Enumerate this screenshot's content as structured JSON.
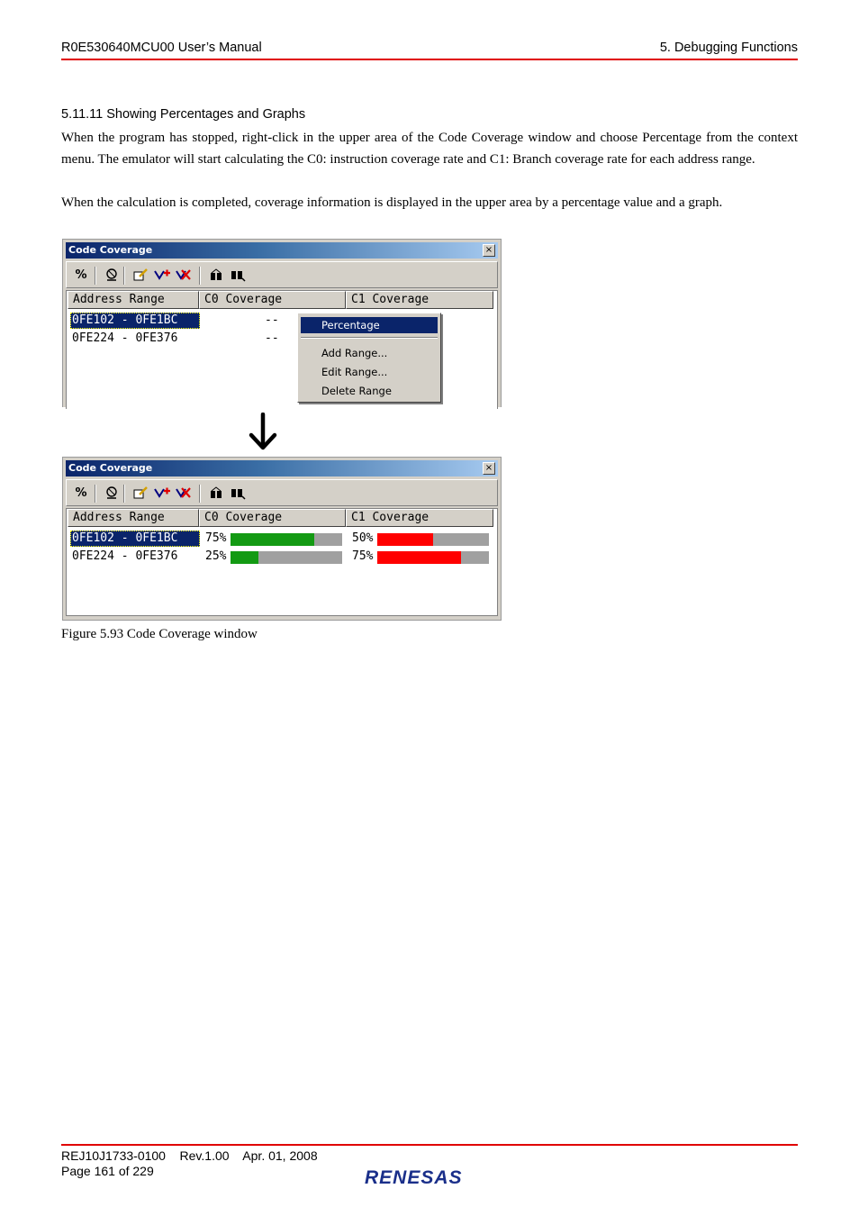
{
  "header": {
    "left": "R0E530640MCU00 User’s Manual",
    "right": "5. Debugging Functions"
  },
  "section_title": "5.11.11 Showing Percentages and Graphs",
  "paragraphs": [
    "When the program has stopped, right-click in the upper area of the Code Coverage window and choose Percentage from the context menu. The emulator will start calculating the C0: instruction coverage rate and C1: Branch coverage rate for each address range.",
    "When the calculation is completed, coverage information is displayed in the upper area by a percentage value and a graph."
  ],
  "window": {
    "title": "Code Coverage",
    "close_glyph": "×",
    "columns": [
      "Address Range",
      "C0 Coverage",
      "C1 Coverage"
    ],
    "toolbar_icons": [
      "percent-icon",
      "coverage-icon",
      "edit-range-icon",
      "add-range-icon",
      "delete-range-icon",
      "refresh-icon",
      "find-icon"
    ],
    "toolbar_percent_label": "%"
  },
  "before": {
    "rows": [
      {
        "range": "0FE102 - 0FE1BC",
        "c0": "--"
      },
      {
        "range": "0FE224 - 0FE376",
        "c0": "--"
      }
    ],
    "context_menu": {
      "items": [
        "Percentage",
        "Add Range...",
        "Edit Range...",
        "Delete Range"
      ],
      "highlighted": "Percentage"
    }
  },
  "after": {
    "rows": [
      {
        "range": "0FE102 - 0FE1BC",
        "c0_label": "75%",
        "c0_value": 0.75,
        "c1_label": "50%",
        "c1_value": 0.5
      },
      {
        "range": "0FE224 - 0FE376",
        "c0_label": "25%",
        "c0_value": 0.25,
        "c1_label": "75%",
        "c1_value": 0.75
      }
    ],
    "colors": {
      "c0_bar": "#139a13",
      "c1_bar": "#ff0000",
      "bar_bg": "#a0a0a0"
    }
  },
  "caption": "Figure 5.93 Code Coverage window",
  "footer": {
    "doc_line": "REJ10J1733-0100    Rev.1.00    Apr. 01, 2008",
    "page": "Page 161 of 229",
    "logo_text": "RENESAS"
  }
}
